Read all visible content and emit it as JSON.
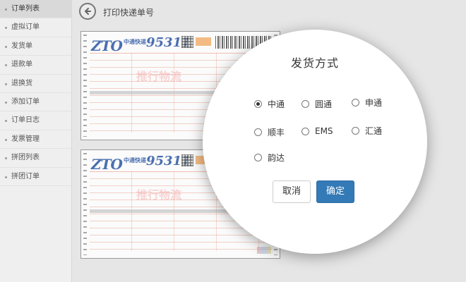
{
  "sidebar": {
    "items": [
      {
        "label": "订单列表",
        "active": true
      },
      {
        "label": "虚拟订单"
      },
      {
        "label": "发货单"
      },
      {
        "label": "退款单"
      },
      {
        "label": "退换货"
      },
      {
        "label": "添加订单"
      },
      {
        "label": "订单日志"
      },
      {
        "label": "发票管理"
      },
      {
        "label": "拼团列表"
      },
      {
        "label": "拼团订单"
      }
    ]
  },
  "header": {
    "title": "打印快递单号",
    "back_icon": "arrow-left-circle-icon"
  },
  "waybill": {
    "logo": "ZTO",
    "brand": "中通快递",
    "hotline": "95311",
    "watermark": "推行物流"
  },
  "modal": {
    "title": "发货方式",
    "options": [
      {
        "label": "中通",
        "checked": true
      },
      {
        "label": "圆通",
        "checked": false
      },
      {
        "label": "申通",
        "checked": false
      },
      {
        "label": "顺丰",
        "checked": false
      },
      {
        "label": "EMS",
        "checked": false
      },
      {
        "label": "汇通",
        "checked": false
      },
      {
        "label": "韵达",
        "checked": false
      }
    ],
    "cancel_label": "取消",
    "confirm_label": "确定"
  },
  "colors": {
    "primary": "#337ab7",
    "waybill_blue": "#4a6fb0",
    "waybill_red": "#e07a5f"
  }
}
